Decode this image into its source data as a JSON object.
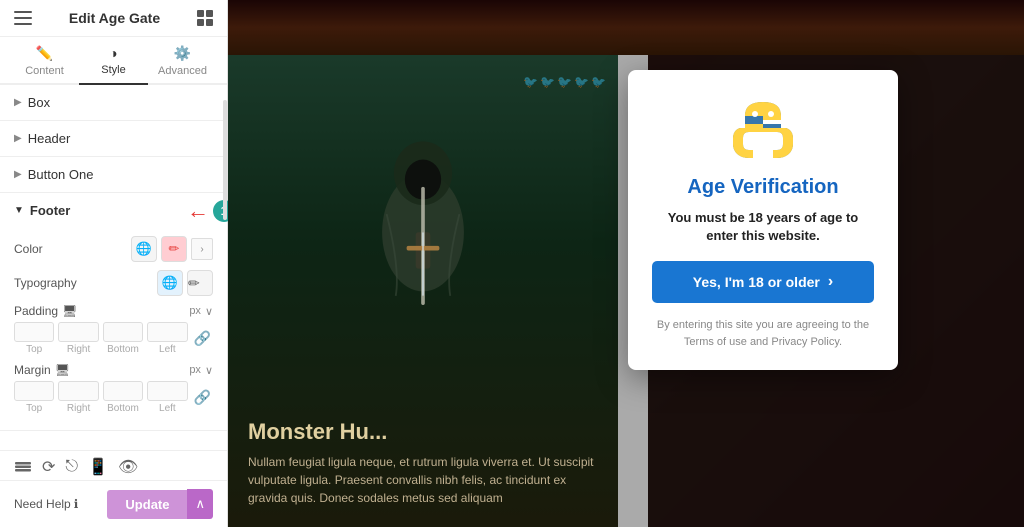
{
  "panel": {
    "title": "Edit Age Gate",
    "tabs": [
      {
        "id": "content",
        "label": "Content",
        "icon": "✏️"
      },
      {
        "id": "style",
        "label": "Style",
        "icon": "◑",
        "active": true
      },
      {
        "id": "advanced",
        "label": "Advanced",
        "icon": "⚙️"
      }
    ],
    "sections": [
      {
        "id": "box",
        "label": "Box",
        "open": false
      },
      {
        "id": "header",
        "label": "Header",
        "open": false
      },
      {
        "id": "button-one",
        "label": "Button One",
        "open": false
      },
      {
        "id": "footer",
        "label": "Footer",
        "open": true
      }
    ],
    "footer_section": {
      "color_label": "Color",
      "typography_label": "Typography",
      "padding_label": "Padding",
      "padding_unit": "px",
      "margin_label": "Margin",
      "margin_unit": "px",
      "padding_fields": [
        "",
        "",
        "",
        ""
      ],
      "padding_sublabels": [
        "Top",
        "Right",
        "Bottom",
        "Left"
      ],
      "margin_fields": [
        "",
        "",
        "",
        ""
      ],
      "margin_sublabels": [
        "Top",
        "Right",
        "Bottom",
        "Left"
      ]
    },
    "badge_number": "1",
    "need_help_label": "Need Help",
    "update_btn_label": "Update"
  },
  "modal": {
    "title": "Age Verification",
    "subtitle": "You must be 18 years of age to enter this website.",
    "button_label": "Yes, I'm 18 or older",
    "footer_text": "By entering this site you are agreeing to the Terms of use and Privacy Policy."
  },
  "content": {
    "title": "Monster Hu...",
    "body_text": "Nullam feugiat ligula neque, et rutrum ligula viverra et. Ut suscipit vulputate ligula. Praesent convallis nibh felis, ac tincidunt ex gravida quis. Donec sodales metus sed aliquam"
  },
  "colors": {
    "accent_purple": "#ce93d8",
    "accent_blue": "#1976d2",
    "teal_badge": "#26a69a",
    "red_arrow": "#e53935"
  }
}
